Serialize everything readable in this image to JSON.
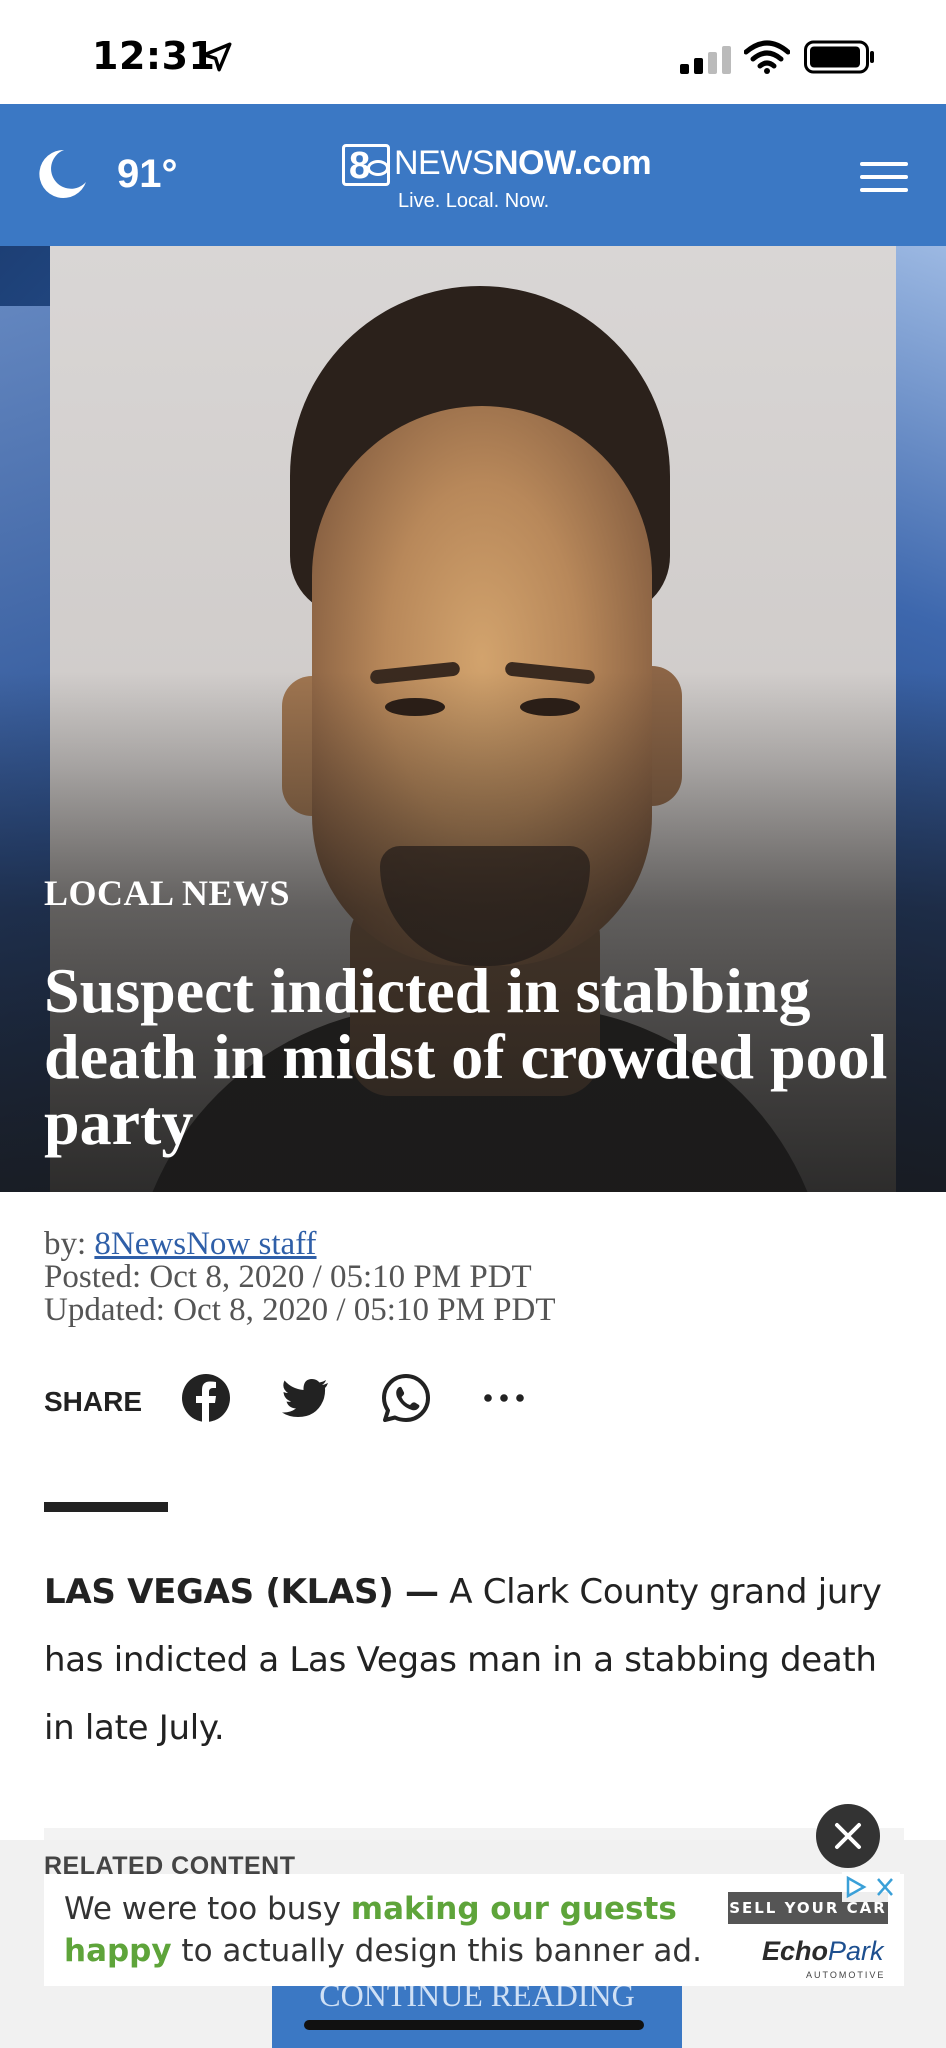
{
  "status_bar": {
    "time": "12:31",
    "icons": [
      "location-arrow-icon",
      "cellular-signal-icon",
      "wifi-icon",
      "battery-icon"
    ]
  },
  "header": {
    "weather_icon": "moon-icon",
    "temperature": "91°",
    "logo_badge": "8",
    "logo_news": "NEWS",
    "logo_now": "NOW",
    "logo_com": ".com",
    "tagline": "Live. Local. Now.",
    "menu_icon": "hamburger-menu-icon",
    "background_color": "#3b78c4"
  },
  "article": {
    "category": "LOCAL NEWS",
    "title": "Suspect indicted in stabbing death in midst of crowded pool party",
    "byline_prefix": "by:",
    "author": "8NewsNow staff",
    "posted": "Posted: Oct 8, 2020 / 05:10 PM PDT",
    "updated": "Updated: Oct 8, 2020 / 05:10 PM PDT",
    "dateline": "LAS VEGAS (KLAS) —",
    "lead": " A Clark County grand jury has indicted a Las Vegas man in a stabbing death in late July."
  },
  "share": {
    "label": "SHARE",
    "icons": [
      "facebook-icon",
      "twitter-icon",
      "whatsapp-icon",
      "more-icon"
    ]
  },
  "ad": {
    "related_label": "RELATED CONTENT",
    "text_1": "We were too busy ",
    "text_highlight": "making our guests happy",
    "text_2": " to actually design this banner ad.",
    "sell_label": "SELL YOUR CAR",
    "brand_echo": "Echo",
    "brand_park": "Park",
    "brand_sub": "AUTOMOTIVE",
    "highlight_color": "#5ea43a"
  },
  "continue_label": "CONTINUE READING"
}
